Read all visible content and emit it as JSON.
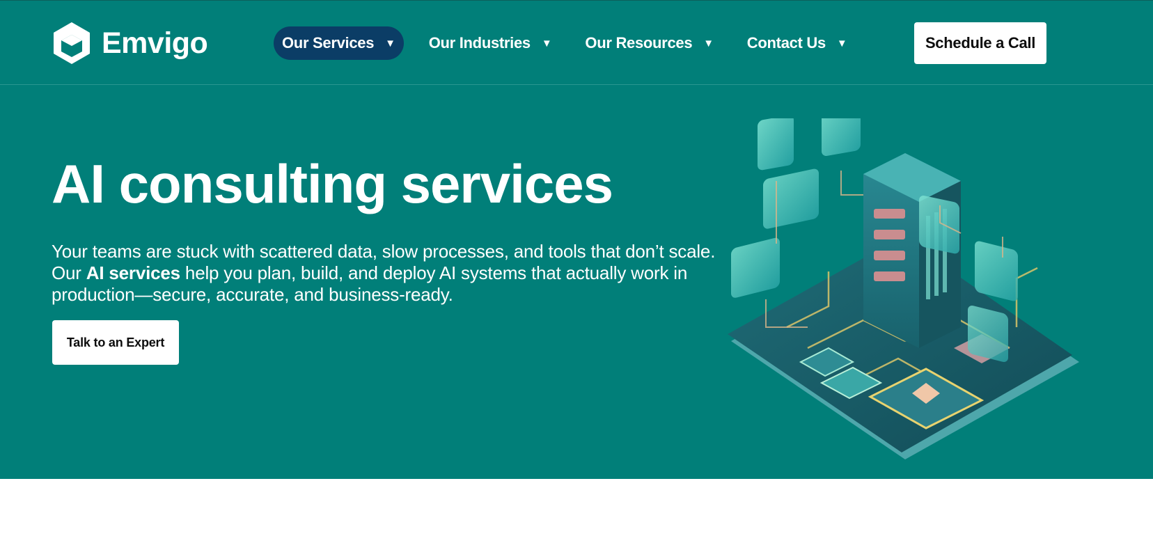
{
  "brand": {
    "name": "Emvigo",
    "logo_icon": "cube-logo-icon"
  },
  "colors": {
    "primary": "#017f79",
    "nav_active": "#0b3d66",
    "button_bg": "#ffffff",
    "text_on_primary": "#ffffff"
  },
  "nav": {
    "items": [
      {
        "label": "Our Services",
        "icon": "caret-down-icon",
        "active": true
      },
      {
        "label": "Our Industries",
        "icon": "caret-down-icon",
        "active": false
      },
      {
        "label": "Our Resources",
        "icon": "caret-down-icon",
        "active": false
      },
      {
        "label": "Contact Us",
        "icon": "caret-down-icon",
        "active": false
      }
    ],
    "cta_label": "Schedule a Call"
  },
  "hero": {
    "title": "AI consulting services",
    "description_part1": "Your teams are stuck with scattered data, slow processes, and tools that don’t scale. Our ",
    "description_bold": "AI services",
    "description_part2": " help you plan, build, and deploy AI systems that actually work in production—secure, accurate, and business-ready.",
    "cta_label": "Talk to an Expert",
    "illustration": "isometric-ai-server-illustration"
  }
}
